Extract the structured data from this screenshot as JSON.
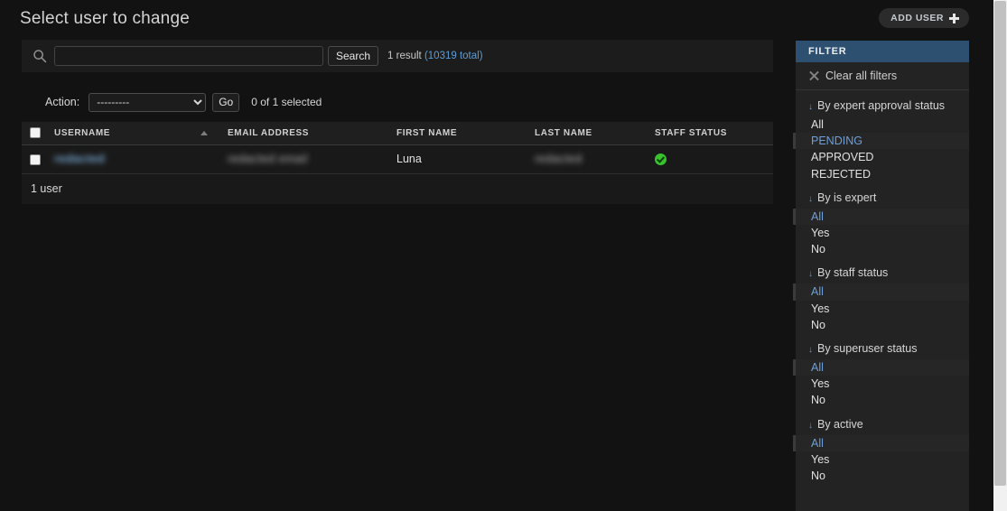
{
  "header": {
    "title": "Select user to change",
    "add_button_label": "ADD USER",
    "add_icon": "plus-icon"
  },
  "search": {
    "icon": "search-icon",
    "value": "",
    "placeholder": "",
    "submit_label": "Search",
    "result_text": "1 result",
    "total_text": "(10319 total)"
  },
  "actions": {
    "label": "Action:",
    "selected_option": "---------",
    "options": [
      "---------"
    ],
    "go_label": "Go",
    "counter": "0 of 1 selected"
  },
  "table": {
    "columns": [
      {
        "key": "check",
        "label": ""
      },
      {
        "key": "username",
        "label": "USERNAME",
        "sorted": "asc"
      },
      {
        "key": "email",
        "label": "EMAIL ADDRESS"
      },
      {
        "key": "first_name",
        "label": "FIRST NAME"
      },
      {
        "key": "last_name",
        "label": "LAST NAME"
      },
      {
        "key": "staff_status",
        "label": "STAFF STATUS"
      }
    ],
    "rows": [
      {
        "username": "redacted",
        "username_redacted": true,
        "email": "redacted email",
        "email_redacted": true,
        "first_name": "Luna",
        "last_name": "redacted",
        "last_name_redacted": true,
        "staff_status": "yes",
        "staff_status_icon": "check-circle-icon"
      }
    ],
    "paginator": "1 user"
  },
  "filter": {
    "title": "FILTER",
    "clear_label": "Clear all filters",
    "clear_icon": "x-icon",
    "groups": [
      {
        "title": "By expert approval status",
        "arrow": "↓",
        "choices": [
          {
            "label": "All",
            "selected": false
          },
          {
            "label": "PENDING",
            "selected": true
          },
          {
            "label": "APPROVED",
            "selected": false
          },
          {
            "label": "REJECTED",
            "selected": false
          }
        ]
      },
      {
        "title": "By is expert",
        "arrow": "↓",
        "choices": [
          {
            "label": "All",
            "selected": true
          },
          {
            "label": "Yes",
            "selected": false
          },
          {
            "label": "No",
            "selected": false
          }
        ]
      },
      {
        "title": "By staff status",
        "arrow": "↓",
        "choices": [
          {
            "label": "All",
            "selected": true
          },
          {
            "label": "Yes",
            "selected": false
          },
          {
            "label": "No",
            "selected": false
          }
        ]
      },
      {
        "title": "By superuser status",
        "arrow": "↓",
        "choices": [
          {
            "label": "All",
            "selected": true
          },
          {
            "label": "Yes",
            "selected": false
          },
          {
            "label": "No",
            "selected": false
          }
        ]
      },
      {
        "title": "By active",
        "arrow": "↓",
        "choices": [
          {
            "label": "All",
            "selected": true
          },
          {
            "label": "Yes",
            "selected": false
          },
          {
            "label": "No",
            "selected": false
          }
        ]
      }
    ]
  },
  "colors": {
    "page_bg": "#121212",
    "panel_bg": "#1c1c1c",
    "filter_header_bg": "#2e5070",
    "link": "#5b9dd9",
    "success": "#37c22e"
  }
}
